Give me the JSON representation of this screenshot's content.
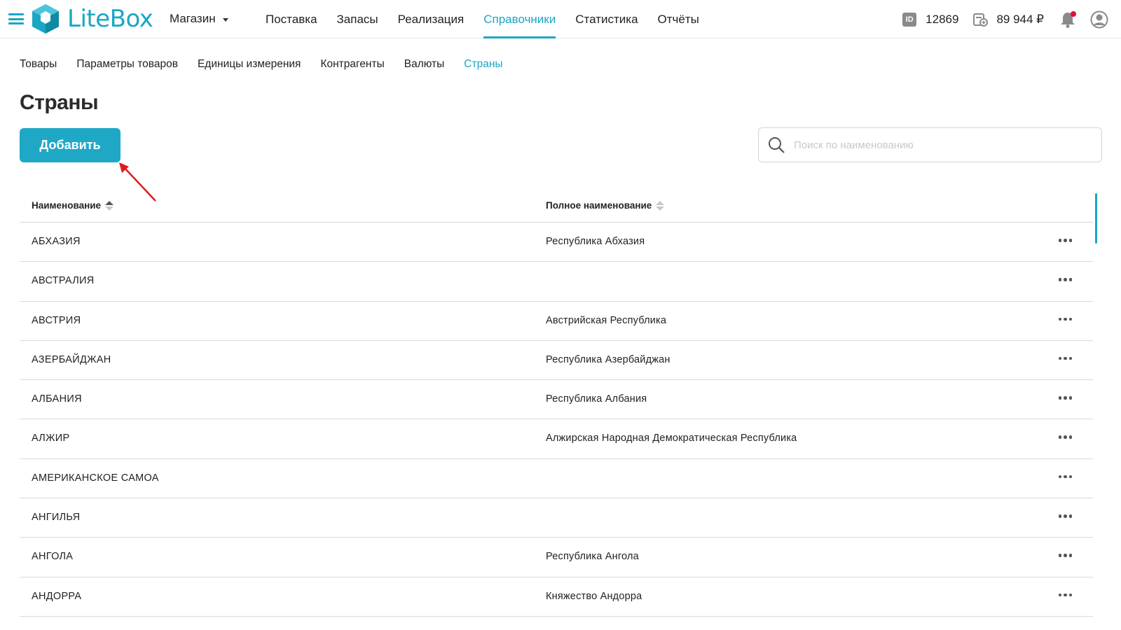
{
  "header": {
    "logo_text": "LiteBox",
    "store_label": "Магазин",
    "nav": [
      {
        "label": "Поставка"
      },
      {
        "label": "Запасы"
      },
      {
        "label": "Реализация"
      },
      {
        "label": "Справочники",
        "active": true
      },
      {
        "label": "Статистика"
      },
      {
        "label": "Отчёты"
      }
    ],
    "account_id_icon_text": "ID",
    "account_id": "12869",
    "balance": "89 944 ₽"
  },
  "subnav": [
    {
      "label": "Товары"
    },
    {
      "label": "Параметры товаров"
    },
    {
      "label": "Единицы измерения"
    },
    {
      "label": "Контрагенты"
    },
    {
      "label": "Валюты"
    },
    {
      "label": "Страны",
      "active": true
    }
  ],
  "page": {
    "title": "Страны",
    "add_button": "Добавить"
  },
  "search": {
    "placeholder": "Поиск по наименованию",
    "value": ""
  },
  "table": {
    "columns": [
      "Наименование",
      "Полное наименование"
    ],
    "rows": [
      {
        "name": "АБХАЗИЯ",
        "full_name": "Республика Абхазия"
      },
      {
        "name": "АВСТРАЛИЯ",
        "full_name": ""
      },
      {
        "name": "АВСТРИЯ",
        "full_name": "Австрийская Республика"
      },
      {
        "name": "АЗЕРБАЙДЖАН",
        "full_name": "Республика Азербайджан"
      },
      {
        "name": "АЛБАНИЯ",
        "full_name": "Республика Албания"
      },
      {
        "name": "АЛЖИР",
        "full_name": "Алжирская Народная Демократическая Республика"
      },
      {
        "name": "АМЕРИКАНСКОЕ САМОА",
        "full_name": ""
      },
      {
        "name": "АНГИЛЬЯ",
        "full_name": ""
      },
      {
        "name": "АНГОЛА",
        "full_name": "Республика Ангола"
      },
      {
        "name": "АНДОРРА",
        "full_name": "Княжество Андорра"
      }
    ]
  },
  "colors": {
    "accent": "#1aa6c4",
    "button": "#1fa8c6",
    "annotation_arrow": "#e01b1b",
    "notification_dot": "#e0103c"
  },
  "icons": [
    "menu-icon",
    "logo-cube-icon",
    "id-icon",
    "wallet-icon",
    "bell-icon",
    "user-avatar-icon",
    "search-icon",
    "more-dots-icon",
    "sort-icon"
  ]
}
